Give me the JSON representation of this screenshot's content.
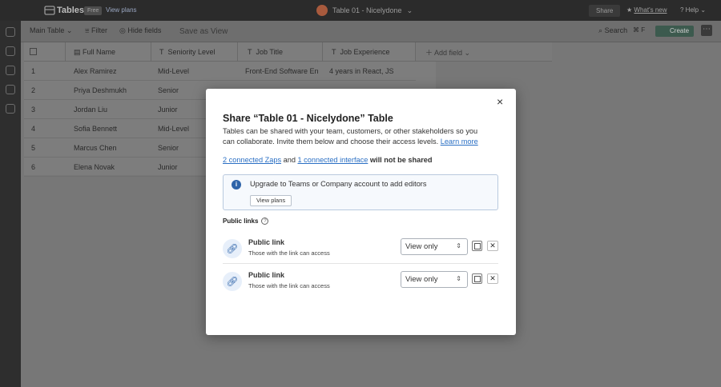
{
  "topbar": {
    "app_title": "Tables",
    "badge": "Free",
    "view_plans": "View plans",
    "table_name": "Table 01 - Nicelydone",
    "share": "Share",
    "whats_new": "What's new",
    "help": "Help"
  },
  "toolbar": {
    "view_name": "Main Table",
    "filter": "Filter",
    "hide_fields": "Hide fields",
    "save_as_view": "Save as View",
    "search": "Search",
    "shortcut": "⌘ F",
    "create": "Create"
  },
  "grid": {
    "columns": [
      "Full Name",
      "Seniority Level",
      "Job Title",
      "Job Experience"
    ],
    "add_field": "Add field",
    "rows": [
      {
        "num": "1",
        "name": "Alex Ramirez",
        "level": "Mid-Level",
        "title": "Front-End Software En",
        "exp": "4 years in React, JS"
      },
      {
        "num": "2",
        "name": "Priya Deshmukh",
        "level": "Senior",
        "title": "",
        "exp": ""
      },
      {
        "num": "3",
        "name": "Jordan Liu",
        "level": "Junior",
        "title": "",
        "exp": ""
      },
      {
        "num": "4",
        "name": "Sofia Bennett",
        "level": "Mid-Level",
        "title": "",
        "exp": ""
      },
      {
        "num": "5",
        "name": "Marcus Chen",
        "level": "Senior",
        "title": "",
        "exp": ""
      },
      {
        "num": "6",
        "name": "Elena Novak",
        "level": "Junior",
        "title": "",
        "exp": ""
      }
    ]
  },
  "modal": {
    "close": "×",
    "title": "Share “Table 01 - Nicelydone” Table",
    "desc_pre": "Tables can be shared with your team, customers, or other stakeholders so you can collaborate. Invite them below and choose their access levels. ",
    "learn_more": "Learn more",
    "zaps_link": "2 connected Zaps",
    "zaps_and": " and ",
    "interface_link": "1 connected interface",
    "zaps_post": " will not be shared",
    "notice": "Upgrade to Teams or Company account to add editors",
    "view_plans": "View plans",
    "public_links_label": "Public links",
    "links": [
      {
        "title": "Public link",
        "subtitle": "Those with the link can access",
        "access": "View only"
      },
      {
        "title": "Public link",
        "subtitle": "Those with the link can access",
        "access": "View only"
      }
    ]
  },
  "colors": {
    "accent": "#2a6fc4",
    "info": "#2f64a9",
    "topbar": "#2b2b2b"
  }
}
